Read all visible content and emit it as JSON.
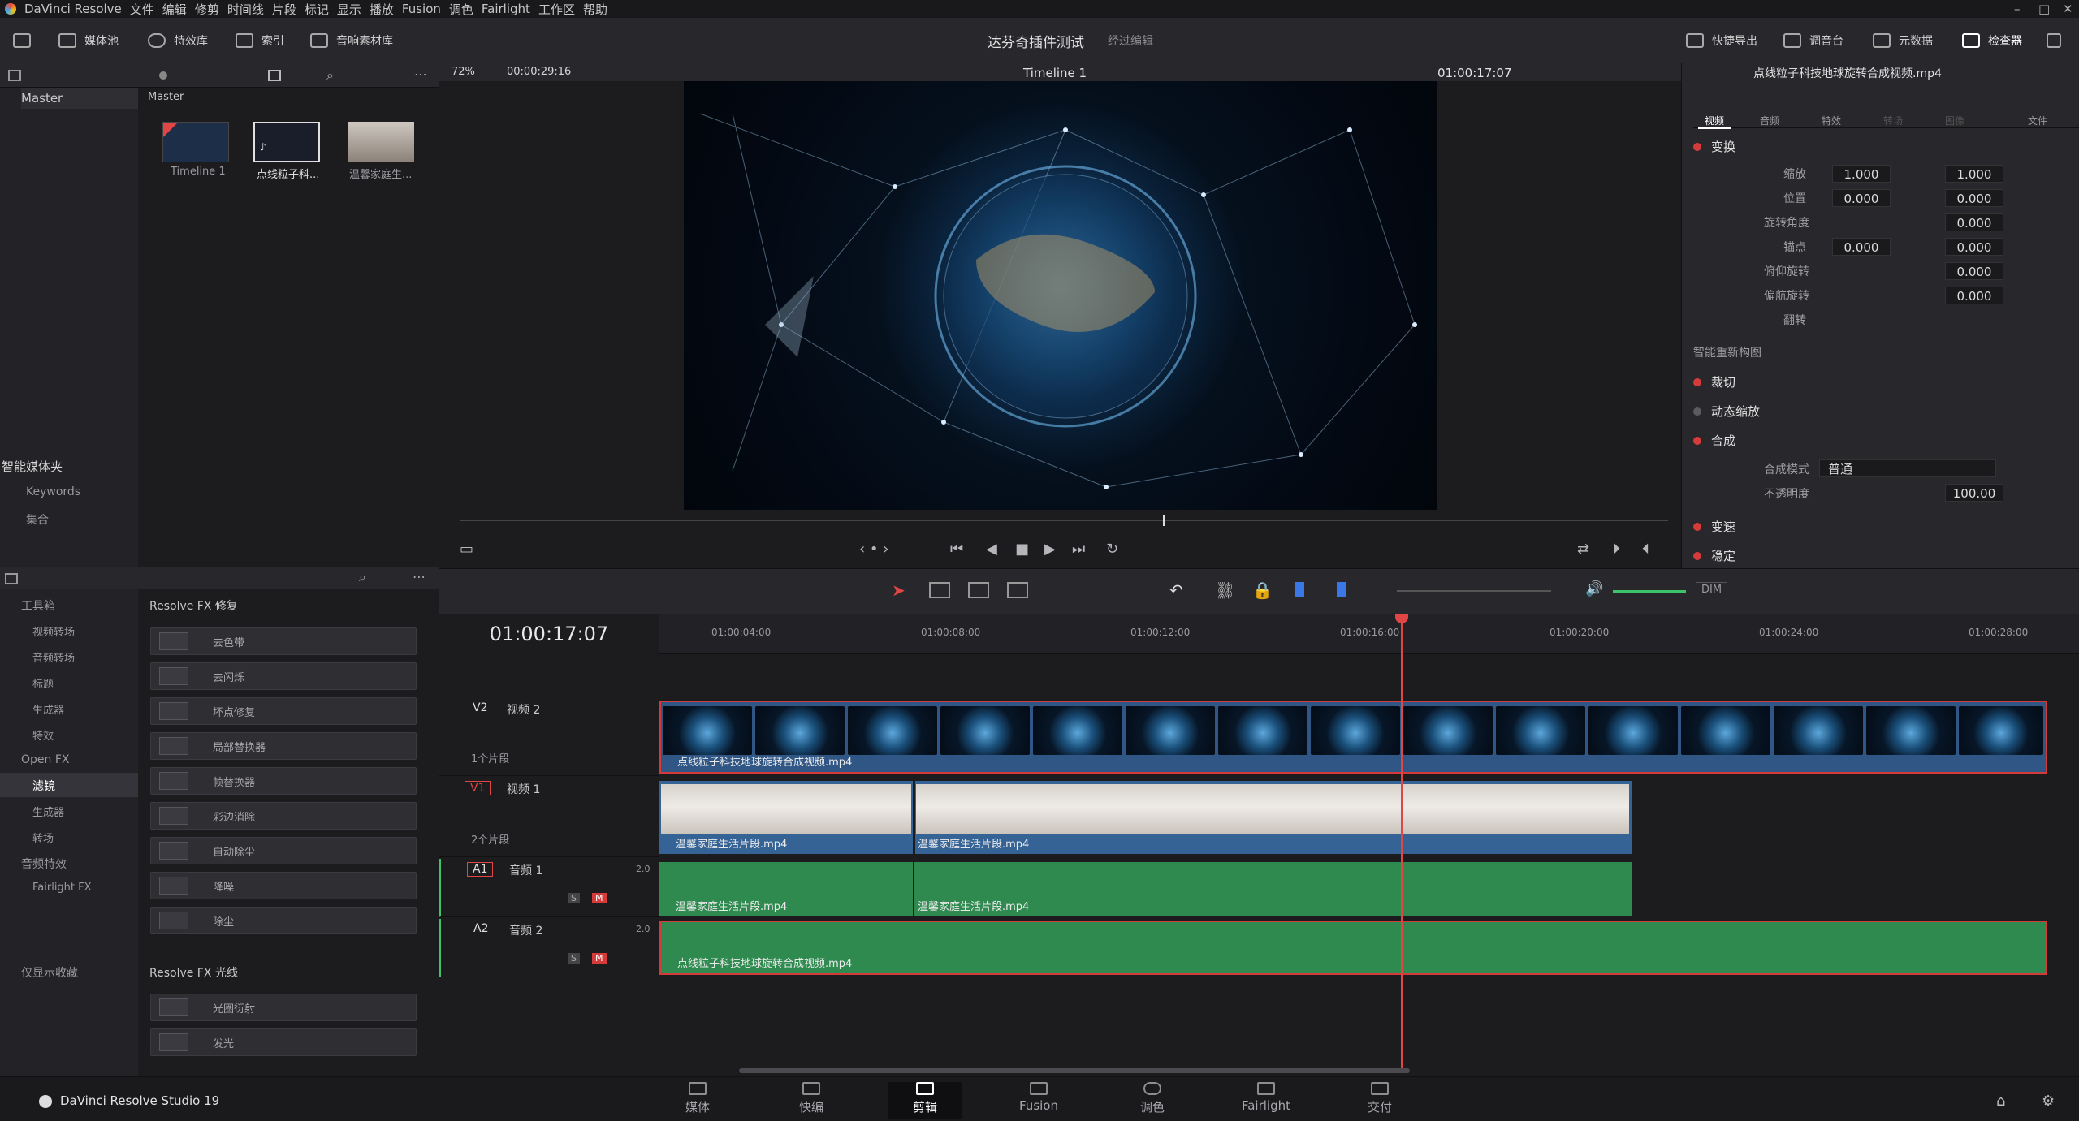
{
  "menu": [
    "DaVinci Resolve",
    "文件",
    "编辑",
    "修剪",
    "时间线",
    "片段",
    "标记",
    "显示",
    "播放",
    "Fusion",
    "调色",
    "Fairlight",
    "工作区",
    "帮助"
  ],
  "toolbar": {
    "media_pool": "媒体池",
    "effects": "特效库",
    "index": "索引",
    "sound_library": "音响素材库",
    "project_title": "达芬奇插件测试",
    "edited_status": "经过编辑",
    "quick_export": "快捷导出",
    "mixer": "调音台",
    "metadata": "元数据",
    "inspector": "检查器"
  },
  "viewer": {
    "zoom": "72%",
    "source_tc": "00:00:29:16",
    "timeline_name": "Timeline 1",
    "record_tc": "01:00:17:07"
  },
  "media": {
    "header": "Master",
    "bin": "Master",
    "clips": [
      {
        "label": "Timeline 1"
      },
      {
        "label": "点线粒子科..."
      },
      {
        "label": "温馨家庭生..."
      }
    ],
    "smart_bins": "智能媒体夹",
    "keywords": "Keywords",
    "collections": "集合"
  },
  "effects": {
    "tree": [
      {
        "label": "工具箱"
      },
      {
        "label": "视频转场"
      },
      {
        "label": "音频转场"
      },
      {
        "label": "标题"
      },
      {
        "label": "生成器"
      },
      {
        "label": "特效"
      },
      {
        "label": "Open FX"
      },
      {
        "label": "滤镜"
      },
      {
        "label": "生成器"
      },
      {
        "label": "转场"
      },
      {
        "label": "音频特效"
      },
      {
        "label": "Fairlight FX"
      }
    ],
    "favorites": "仅显示收藏",
    "group1": "Resolve FX 修复",
    "items1": [
      "去色带",
      "去闪烁",
      "坏点修复",
      "局部替换器",
      "帧替换器",
      "彩边消除",
      "自动除尘",
      "降噪",
      "除尘"
    ],
    "group2": "Resolve FX 光线",
    "items2": [
      "光圈衍射",
      "发光"
    ]
  },
  "inspector": {
    "clip_title": "点线粒子科技地球旋转合成视频.mp4",
    "tabs": [
      "视频",
      "音频",
      "特效",
      "转场",
      "图像",
      "文件"
    ],
    "transform": "变换",
    "zoom_label": "缩放",
    "zoom_x": "1.000",
    "zoom_y": "1.000",
    "position_label": "位置",
    "pos_x": "0.000",
    "pos_y": "0.000",
    "rotation_label": "旋转角度",
    "rotation": "0.000",
    "anchor_label": "锚点",
    "anchor_x": "0.000",
    "anchor_y": "0.000",
    "pitch_label": "俯仰旋转",
    "pitch": "0.000",
    "yaw_label": "偏航旋转",
    "yaw": "0.000",
    "flip_label": "翻转",
    "smart_reframe": "智能重新构图",
    "crop": "裁切",
    "dynamic_zoom": "动态缩放",
    "composite": "合成",
    "blend_mode_label": "合成模式",
    "blend_mode": "普通",
    "opacity_label": "不透明度",
    "opacity": "100.00",
    "speed": "变速",
    "stabilize": "稳定"
  },
  "timeline": {
    "timecode": "01:00:17:07",
    "ruler": [
      "01:00:04:00",
      "01:00:08:00",
      "01:00:12:00",
      "01:00:16:00",
      "01:00:20:00",
      "01:00:24:00",
      "01:00:28:00"
    ],
    "tracks": [
      {
        "id": "V2",
        "name": "视频 2",
        "count": "1个片段",
        "fmt": ""
      },
      {
        "id": "V1",
        "name": "视频 1",
        "count": "2个片段",
        "fmt": ""
      },
      {
        "id": "A1",
        "name": "音频 1",
        "count": "",
        "fmt": "2.0"
      },
      {
        "id": "A2",
        "name": "音频 2",
        "count": "",
        "fmt": "2.0"
      }
    ],
    "v2_clip": "点线粒子科技地球旋转合成视频.mp4",
    "v1_clip_a": "温馨家庭生活片段.mp4",
    "v1_clip_b": "温馨家庭生活片段.mp4",
    "a1_clip_a": "温馨家庭生活片段.mp4",
    "a1_clip_b": "温馨家庭生活片段.mp4",
    "a2_clip": "点线粒子科技地球旋转合成视频.mp4",
    "dim": "DIM",
    "solo": "S",
    "mute": "M"
  },
  "pages": [
    "媒体",
    "快编",
    "剪辑",
    "Fusion",
    "调色",
    "Fairlight",
    "交付"
  ],
  "brand": "DaVinci Resolve Studio 19",
  "colors": {
    "accent_red": "#d53a3a",
    "video_clip": "#2f5684",
    "audio_clip": "#2f8a4f"
  }
}
